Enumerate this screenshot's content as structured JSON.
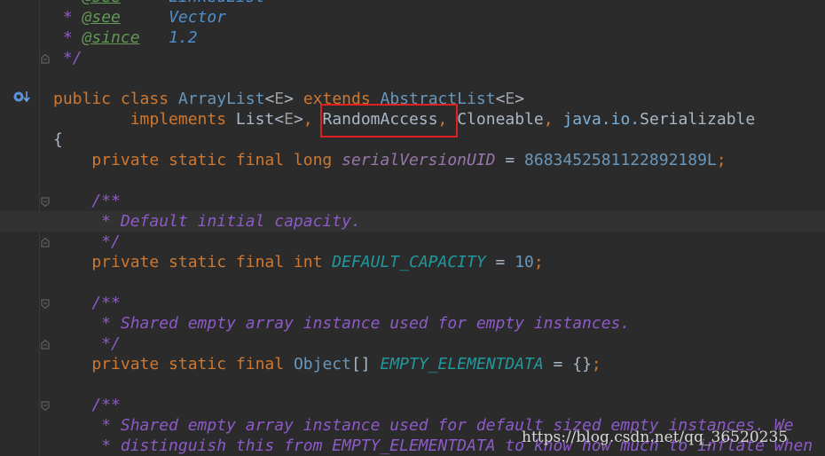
{
  "editor": {
    "lines": [
      {
        "parts": [
          {
            "t": " * ",
            "c": "doc"
          },
          {
            "t": "@see",
            "c": "doctag"
          },
          {
            "t": "     ",
            "c": "doc"
          },
          {
            "t": "LinkedList",
            "c": "docval"
          }
        ]
      },
      {
        "parts": [
          {
            "t": " * ",
            "c": "doc"
          },
          {
            "t": "@see",
            "c": "doctag"
          },
          {
            "t": "     ",
            "c": "doc"
          },
          {
            "t": "Vector",
            "c": "docval"
          }
        ]
      },
      {
        "parts": [
          {
            "t": " * ",
            "c": "doc"
          },
          {
            "t": "@since",
            "c": "doctag"
          },
          {
            "t": "   ",
            "c": "doc"
          },
          {
            "t": "1.2",
            "c": "docval"
          }
        ]
      },
      {
        "parts": [
          {
            "t": " */",
            "c": "doc"
          }
        ]
      },
      {
        "parts": []
      },
      {
        "parts": [
          {
            "t": "public class ",
            "c": "kw"
          },
          {
            "t": "ArrayList",
            "c": "type-ref"
          },
          {
            "t": "<",
            "c": "plain"
          },
          {
            "t": "E",
            "c": "gen"
          },
          {
            "t": "> ",
            "c": "plain"
          },
          {
            "t": "extends ",
            "c": "kw"
          },
          {
            "t": "AbstractList",
            "c": "type-ref"
          },
          {
            "t": "<",
            "c": "plain"
          },
          {
            "t": "E",
            "c": "gen"
          },
          {
            "t": ">",
            "c": "plain"
          }
        ]
      },
      {
        "parts": [
          {
            "t": "        implements ",
            "c": "kw"
          },
          {
            "t": "List",
            "c": "plain"
          },
          {
            "t": "<",
            "c": "plain"
          },
          {
            "t": "E",
            "c": "gen"
          },
          {
            "t": ">",
            "c": "plain"
          },
          {
            "t": ", ",
            "c": "punct"
          },
          {
            "t": "RandomAccess",
            "c": "plain"
          },
          {
            "t": ", ",
            "c": "punct"
          },
          {
            "t": "Cloneable",
            "c": "plain"
          },
          {
            "t": ", ",
            "c": "punct"
          },
          {
            "t": "java.io.",
            "c": "ref-blue"
          },
          {
            "t": "Serializable",
            "c": "plain"
          }
        ]
      },
      {
        "parts": [
          {
            "t": "{",
            "c": "plain"
          }
        ]
      },
      {
        "parts": [
          {
            "t": "    private static final long ",
            "c": "kw"
          },
          {
            "t": "serialVersionUID",
            "c": "field"
          },
          {
            "t": " = ",
            "c": "plain"
          },
          {
            "t": "8683452581122892189L",
            "c": "num"
          },
          {
            "t": ";",
            "c": "punct"
          }
        ]
      },
      {
        "parts": []
      },
      {
        "parts": [
          {
            "t": "    /**",
            "c": "doc"
          }
        ]
      },
      {
        "parts": [
          {
            "t": "     * Default initial capacity.",
            "c": "doc"
          }
        ]
      },
      {
        "parts": [
          {
            "t": "     */",
            "c": "doc"
          }
        ]
      },
      {
        "parts": [
          {
            "t": "    private static final int ",
            "c": "kw"
          },
          {
            "t": "DEFAULT_CAPACITY",
            "c": "const"
          },
          {
            "t": " = ",
            "c": "plain"
          },
          {
            "t": "10",
            "c": "num"
          },
          {
            "t": ";",
            "c": "punct"
          }
        ]
      },
      {
        "parts": []
      },
      {
        "parts": [
          {
            "t": "    /**",
            "c": "doc"
          }
        ]
      },
      {
        "parts": [
          {
            "t": "     * Shared empty array instance used for empty instances.",
            "c": "doc"
          }
        ]
      },
      {
        "parts": [
          {
            "t": "     */",
            "c": "doc"
          }
        ]
      },
      {
        "parts": [
          {
            "t": "    private static final ",
            "c": "kw"
          },
          {
            "t": "Object",
            "c": "type-ref"
          },
          {
            "t": "[] ",
            "c": "plain"
          },
          {
            "t": "EMPTY_ELEMENTDATA",
            "c": "const"
          },
          {
            "t": " = {}",
            "c": "plain"
          },
          {
            "t": ";",
            "c": "punct"
          }
        ]
      },
      {
        "parts": []
      },
      {
        "parts": [
          {
            "t": "    /**",
            "c": "doc"
          }
        ]
      },
      {
        "parts": [
          {
            "t": "     * Shared empty array instance used for default sized empty instances. We",
            "c": "doc"
          }
        ]
      },
      {
        "parts": [
          {
            "t": "     * distinguish this from EMPTY_ELEMENTDATA to know how much to inflate when",
            "c": "doc"
          }
        ]
      }
    ]
  },
  "icons": {
    "implements_gutter": "implements-gutter-icon",
    "fold": "fold-marker-icon"
  },
  "colors": {
    "background": "#2b2b2b",
    "keyword": "#cc7832",
    "javadoc": "#8d5ac8",
    "constant": "#20999d",
    "number": "#6897bb",
    "highlight_box": "#e02020"
  },
  "watermark": {
    "text": "https://blog.csdn.net/qq_36520235"
  }
}
